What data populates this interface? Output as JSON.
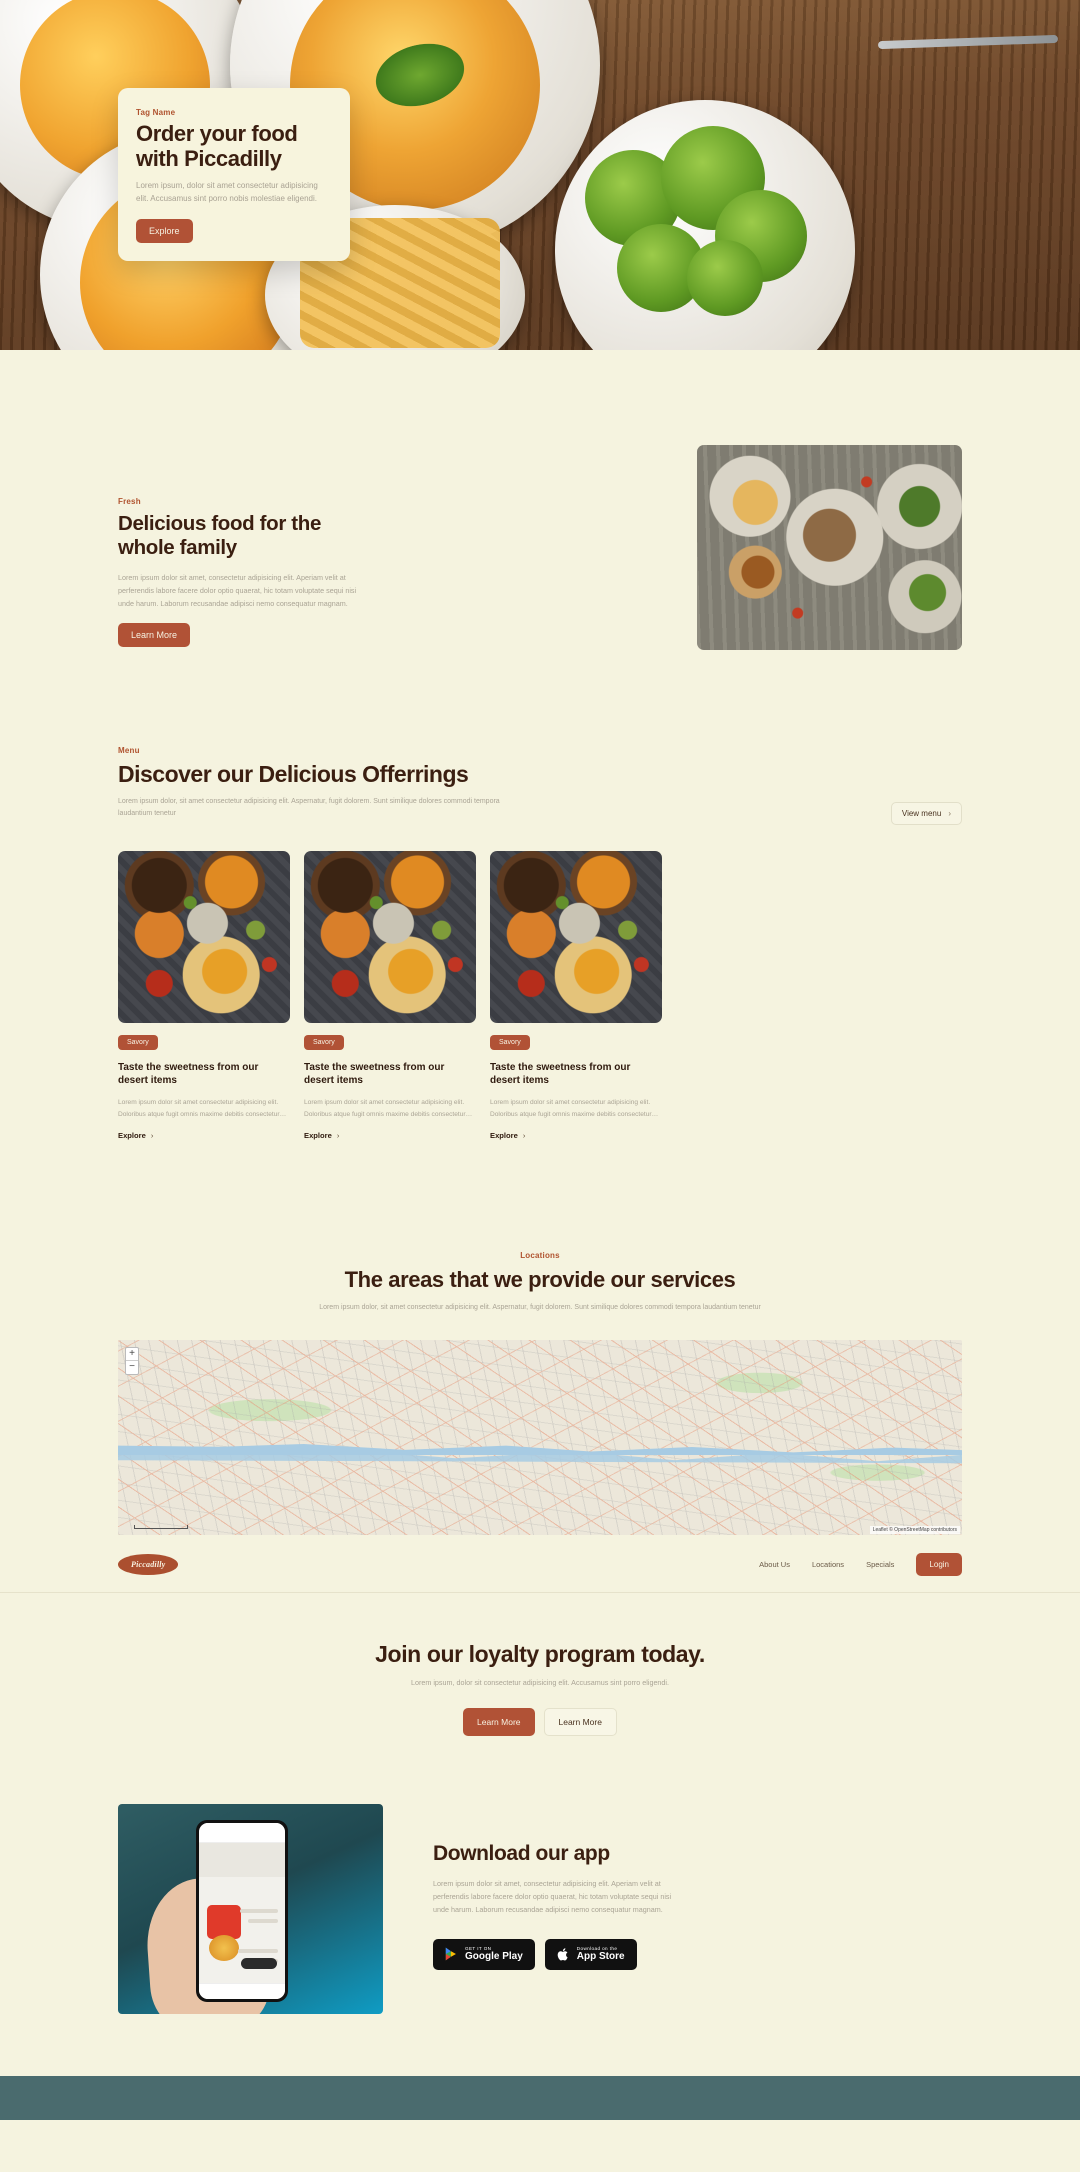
{
  "hero": {
    "tag": "Tag Name",
    "title": "Order your food with Piccadilly",
    "subtitle": "Lorem ipsum, dolor sit amet consectetur adipisicing elit. Accusamus sint porro nobis molestiae eligendi.",
    "cta": "Explore"
  },
  "fresh": {
    "tag": "Fresh",
    "title": "Delicious food for the whole family",
    "body": "Lorem ipsum dolor sit amet, consectetur adipisicing elit. Aperiam velit at perferendis labore facere dolor optio quaerat, hic totam voluptate sequi nisi unde harum. Laborum recusandae adipisci nemo consequatur magnam.",
    "cta": "Learn More"
  },
  "menu": {
    "tag": "Menu",
    "title": "Discover our Delicious Offerrings",
    "subtitle": "Lorem ipsum dolor, sit amet consectetur adipisicing elit. Aspernatur, fugit dolorem. Sunt similique dolores commodi tempora laudantium tenetur",
    "view_menu": "View menu",
    "chevron": "›",
    "cards": [
      {
        "badge": "Savory",
        "title": "Taste the sweetness from our desert items",
        "body": "Lorem ipsum dolor sit amet consectetur adipisicing elit. Doloribus atque fugit omnis maxime debitis consectetur…",
        "link": "Explore"
      },
      {
        "badge": "Savory",
        "title": "Taste the sweetness from our desert items",
        "body": "Lorem ipsum dolor sit amet consectetur adipisicing elit. Doloribus atque fugit omnis maxime debitis consectetur…",
        "link": "Explore"
      },
      {
        "badge": "Savory",
        "title": "Taste the sweetness from our desert items",
        "body": "Lorem ipsum dolor sit amet consectetur adipisicing elit. Doloribus atque fugit omnis maxime debitis consectetur…",
        "link": "Explore"
      }
    ]
  },
  "locations": {
    "tag": "Locations",
    "title": "The areas that we provide our services",
    "subtitle": "Lorem ipsum dolor, sit amet consectetur adipisicing elit. Aspernatur, fugit dolorem. Sunt similique dolores commodi tempora laudantium tenetur",
    "map": {
      "zoom_in": "+",
      "zoom_out": "−",
      "attribution_leaflet": "Leaflet",
      "attribution_osm": "© OpenStreetMap contributors"
    }
  },
  "navbar": {
    "logo": "Piccadilly",
    "links": [
      "About Us",
      "Locations",
      "Specials"
    ],
    "login": "Login"
  },
  "loyalty": {
    "title": "Join our loyalty program today.",
    "subtitle": "Lorem ipsum, dolor sit consectetur adipisicing elit. Accusamus sint porro eligendi.",
    "primary_cta": "Learn More",
    "secondary_cta": "Learn More"
  },
  "app": {
    "title": "Download our app",
    "body": "Lorem ipsum dolor sit amet, consectetur adipisicing elit. Aperiam velit at perferendis labore facere dolor optio quaerat, hic totam voluptate sequi nisi unde harum. Laborum recusandae adipisci nemo consequatur magnam.",
    "google_play": {
      "small": "GET IT ON",
      "big": "Google Play"
    },
    "app_store": {
      "small": "Download on the",
      "big": "App Store"
    }
  },
  "colors": {
    "background": "#f5f3df",
    "accent": "#b15236",
    "heading": "#3b1f11",
    "muted": "#aaa495",
    "footer": "#4a6b6e"
  }
}
